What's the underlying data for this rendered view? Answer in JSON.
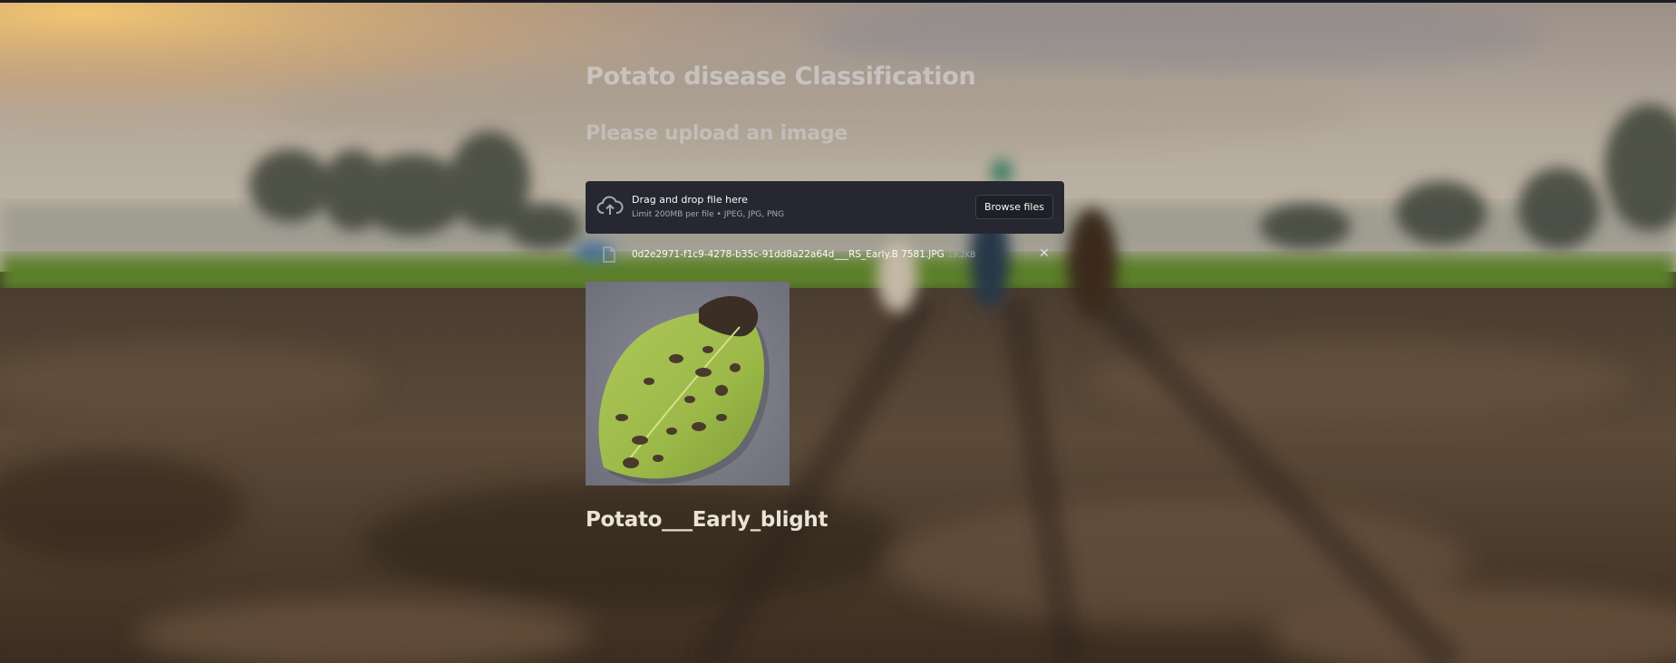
{
  "app": {
    "title": "Potato disease Classification",
    "subtitle": "Please upload an image"
  },
  "uploader": {
    "drag_text": "Drag and drop file here",
    "limit_text": "Limit 200MB per file • JPEG, JPG, PNG",
    "browse_label": "Browse files",
    "upload_icon": "cloud-upload-icon"
  },
  "uploaded_file": {
    "name": "0d2e2971-f1c9-4278-b35c-91dd8a22a64d___RS_Early.B 7581.JPG",
    "size": "19.2KB",
    "file_icon": "file-icon",
    "remove_icon": "close-icon",
    "remove_glyph": "✕"
  },
  "prediction": {
    "label": "Potato___Early_blight"
  },
  "colors": {
    "uploader_bg": "#262730",
    "text_light": "#fafafa",
    "result_text": "#ebe3d8"
  }
}
